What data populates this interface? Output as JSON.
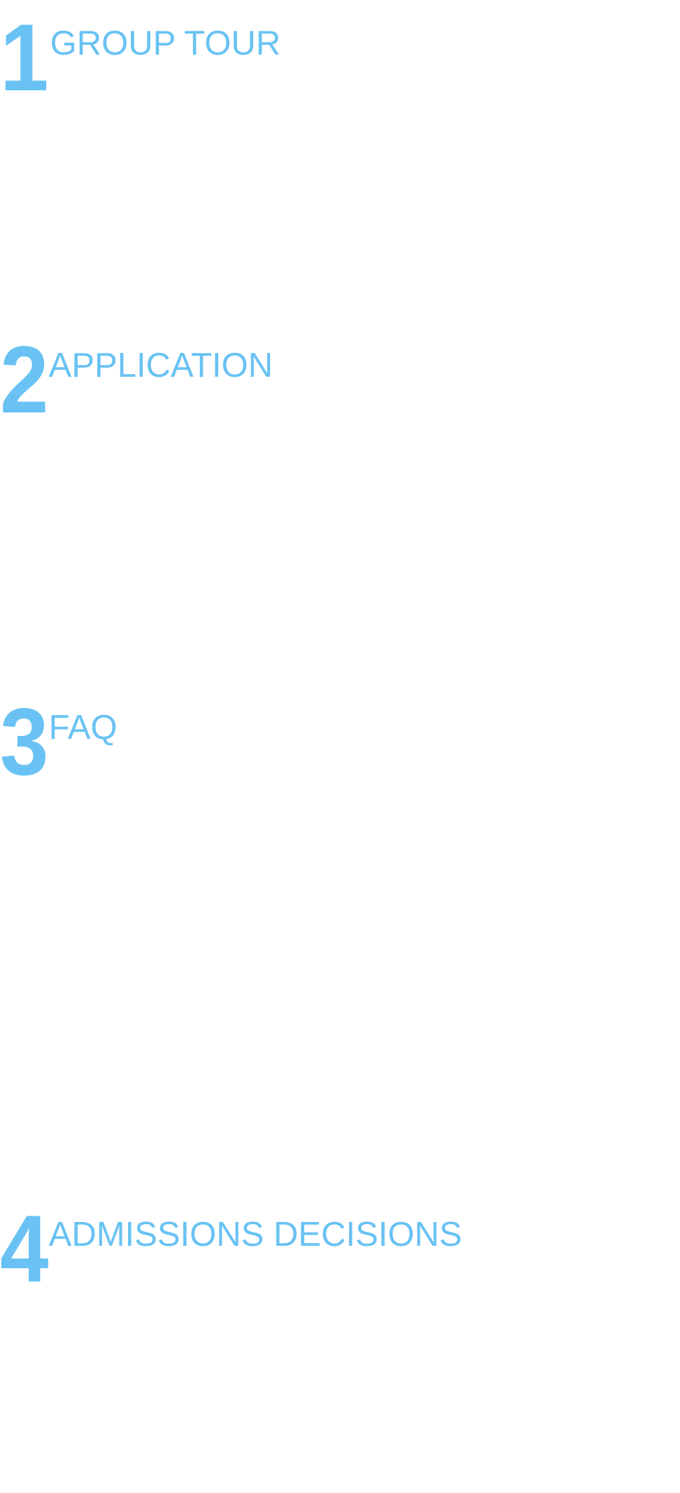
{
  "steps": [
    {
      "number": "1",
      "title": "GROUP TOUR"
    },
    {
      "number": "2",
      "title": "APPLICATION"
    },
    {
      "number": "3",
      "title": "FAQ"
    },
    {
      "number": "4",
      "title": "ADMISSIONS DECISIONS"
    }
  ],
  "colors": {
    "accent": "#69c2f3",
    "background": "#ffffff"
  }
}
